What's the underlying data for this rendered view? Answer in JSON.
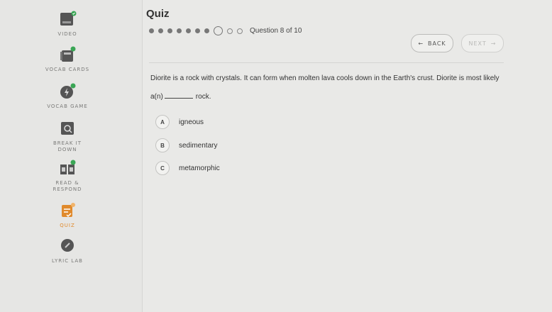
{
  "sidebar": {
    "items": [
      {
        "label": "VIDEO"
      },
      {
        "label": "VOCAB CARDS"
      },
      {
        "label": "VOCAB GAME"
      },
      {
        "label": "BREAK IT DOWN"
      },
      {
        "label": "READ & RESPOND"
      },
      {
        "label": "QUIZ"
      },
      {
        "label": "LYRIC LAB"
      }
    ]
  },
  "header": {
    "title": "Quiz",
    "question_count": "Question 8 of 10"
  },
  "progress": {
    "current": 8,
    "total": 10
  },
  "nav": {
    "back_label": "BACK",
    "next_label": "NEXT"
  },
  "question": {
    "text_line1": "Diorite is a rock with crystals. It can form when molten lava cools down in the Earth's crust. Diorite is most likely",
    "text_prefix": "a(n)",
    "text_suffix": "rock.",
    "choices": [
      {
        "letter": "A",
        "text": "igneous"
      },
      {
        "letter": "B",
        "text": "sedimentary"
      },
      {
        "letter": "C",
        "text": "metamorphic"
      }
    ]
  },
  "colors": {
    "accent": "#e08a2c",
    "check": "#3aa655",
    "topbar": "#f1b46a"
  }
}
